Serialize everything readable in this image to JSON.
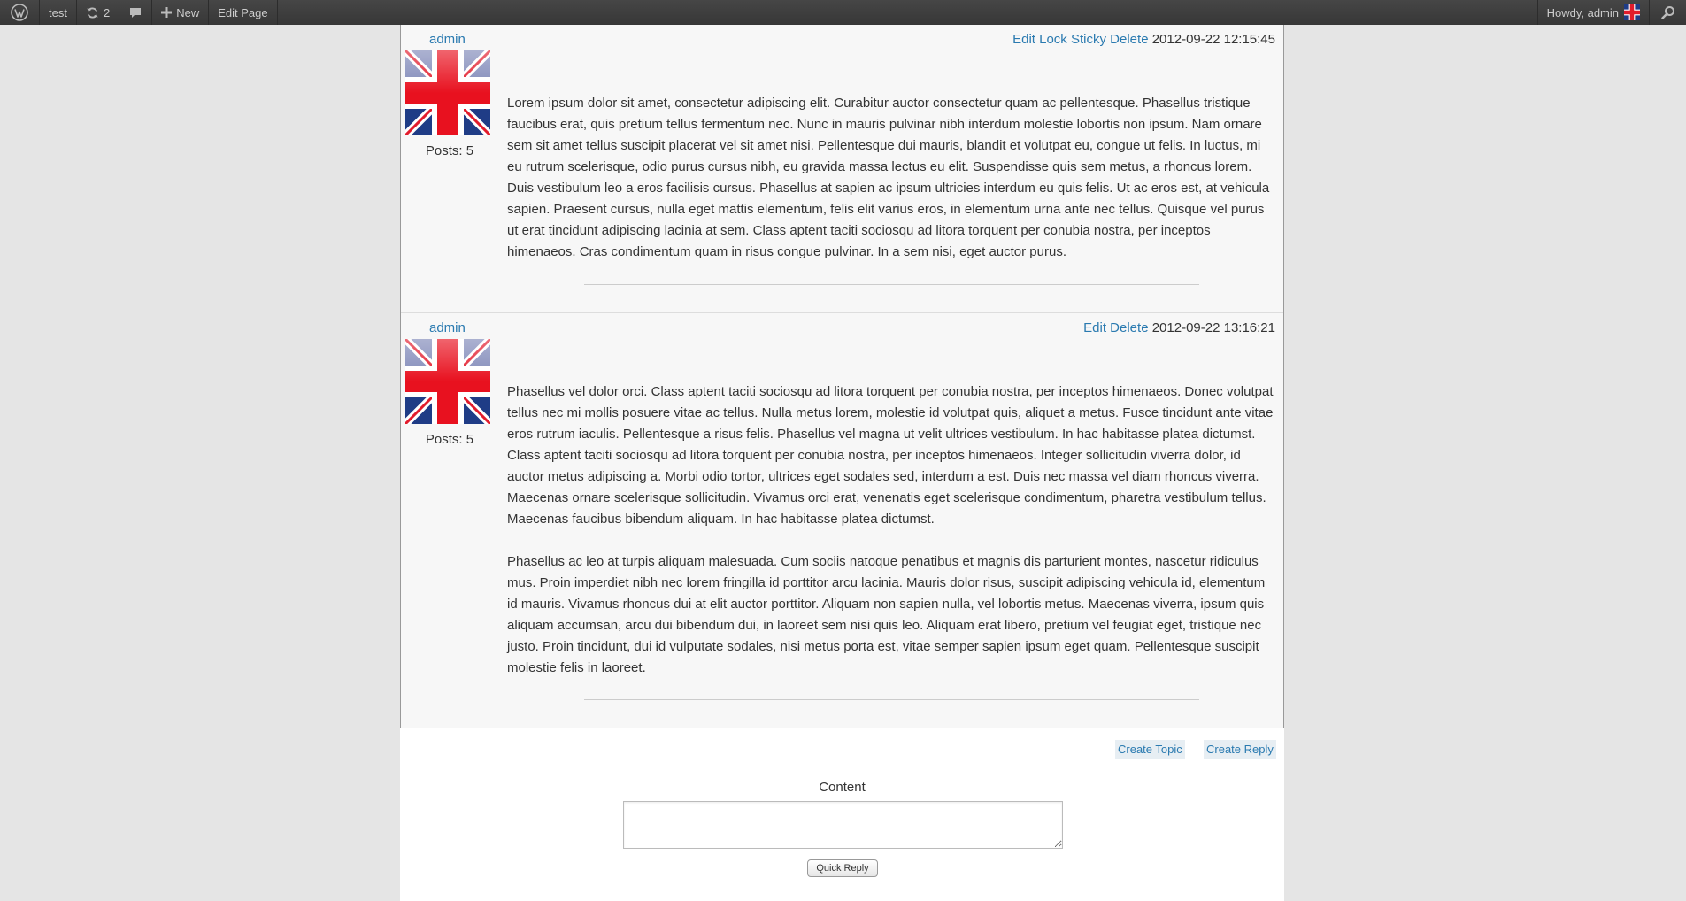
{
  "adminbar": {
    "site_name": "test",
    "updates_count": "2",
    "new_label": "New",
    "edit_page_label": "Edit Page",
    "howdy": "Howdy, admin"
  },
  "posts": [
    {
      "author": "admin",
      "posts_count": "Posts: 5",
      "actions": [
        "Edit",
        "Lock",
        "Sticky",
        "Delete"
      ],
      "timestamp": "2012-09-22 12:15:45",
      "paragraphs": [
        "Lorem ipsum dolor sit amet, consectetur adipiscing elit. Curabitur auctor consectetur quam ac pellentesque. Phasellus tristique faucibus erat, quis pretium tellus fermentum nec. Nunc in mauris pulvinar nibh interdum molestie lobortis non ipsum. Nam ornare sem sit amet tellus suscipit placerat vel sit amet nisi. Pellentesque dui mauris, blandit et volutpat eu, congue ut felis. In luctus, mi eu rutrum scelerisque, odio purus cursus nibh, eu gravida massa lectus eu elit. Suspendisse quis sem metus, a rhoncus lorem. Duis vestibulum leo a eros facilisis cursus. Phasellus at sapien ac ipsum ultricies interdum eu quis felis. Ut ac eros est, at vehicula sapien. Praesent cursus, nulla eget mattis elementum, felis elit varius eros, in elementum urna ante nec tellus. Quisque vel purus ut erat tincidunt adipiscing lacinia at sem. Class aptent taciti sociosqu ad litora torquent per conubia nostra, per inceptos himenaeos. Cras condimentum quam in risus congue pulvinar. In a sem nisi, eget auctor purus."
      ]
    },
    {
      "author": "admin",
      "posts_count": "Posts: 5",
      "actions": [
        "Edit",
        "Delete"
      ],
      "timestamp": "2012-09-22 13:16:21",
      "paragraphs": [
        "Phasellus vel dolor orci. Class aptent taciti sociosqu ad litora torquent per conubia nostra, per inceptos himenaeos. Donec volutpat tellus nec mi mollis posuere vitae ac tellus. Nulla metus lorem, molestie id volutpat quis, aliquet a metus. Fusce tincidunt ante vitae eros rutrum iaculis. Pellentesque a risus felis. Phasellus vel magna ut velit ultrices vestibulum. In hac habitasse platea dictumst. Class aptent taciti sociosqu ad litora torquent per conubia nostra, per inceptos himenaeos. Integer sollicitudin viverra dolor, id auctor metus adipiscing a. Morbi odio tortor, ultrices eget sodales sed, interdum a est. Duis nec massa vel diam rhoncus viverra. Maecenas ornare scelerisque sollicitudin. Vivamus orci erat, venenatis eget scelerisque condimentum, pharetra vestibulum tellus. Maecenas faucibus bibendum aliquam. In hac habitasse platea dictumst.",
        "Phasellus ac leo at turpis aliquam malesuada. Cum sociis natoque penatibus et magnis dis parturient montes, nascetur ridiculus mus. Proin imperdiet nibh nec lorem fringilla id porttitor arcu lacinia. Mauris dolor risus, suscipit adipiscing vehicula id, elementum id mauris. Vivamus rhoncus dui at elit auctor porttitor. Aliquam non sapien nulla, vel lobortis metus. Maecenas viverra, ipsum quis aliquam accumsan, arcu dui bibendum dui, in laoreet sem nisi quis leo. Aliquam erat libero, pretium vel feugiat eget, tristique nec justo. Proin tincidunt, dui id vulputate sodales, nisi metus porta est, vitae semper sapien ipsum eget quam. Pellentesque suscipit molestie felis in laoreet."
      ]
    }
  ],
  "actions": {
    "create_topic": "Create Topic",
    "create_reply": "Create Reply"
  },
  "reply_form": {
    "content_label": "Content",
    "content_value": "",
    "submit_label": "Quick Reply"
  },
  "colors": {
    "link": "#2a7ab0",
    "adminbar_bg": "#464646",
    "page_bg": "#e5e5e5",
    "post_bg": "#f7f7f7"
  },
  "icons": {
    "wp_logo": "wordpress-logo-icon",
    "updates": "refresh-icon",
    "comments": "comment-bubble-icon",
    "new": "plus-icon",
    "search": "search-icon",
    "avatar": "union-flag-avatar"
  }
}
